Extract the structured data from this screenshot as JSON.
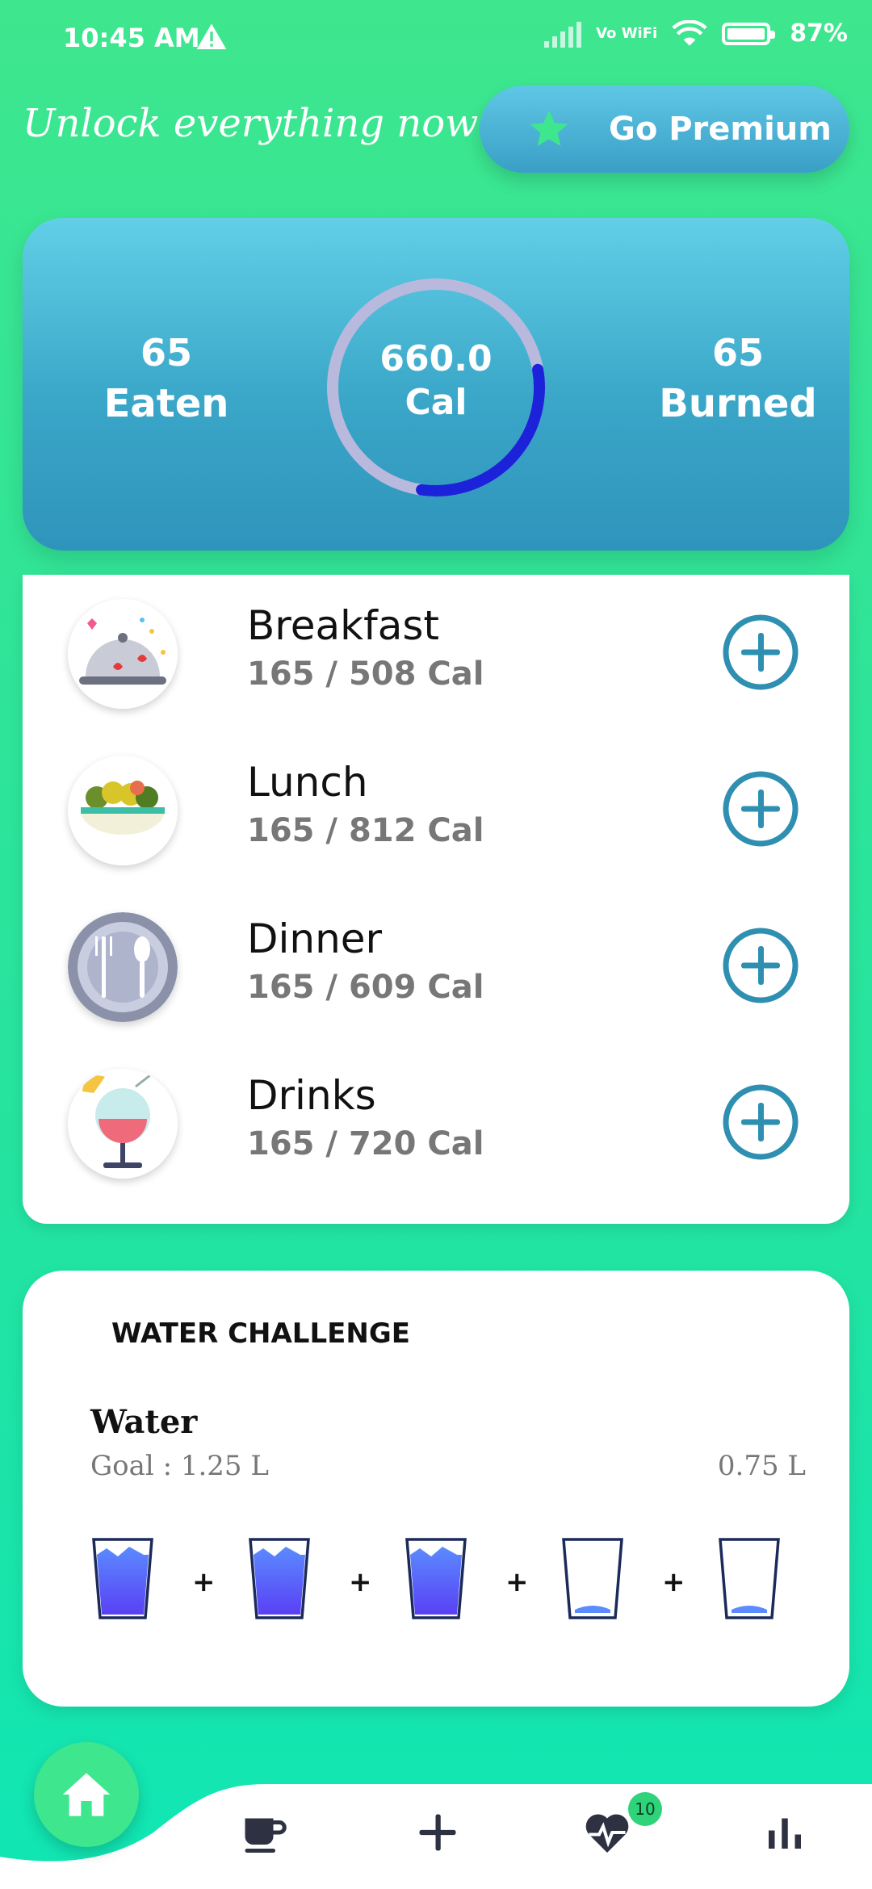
{
  "status_bar": {
    "time": "10:45 AM",
    "network": "Vo WiFi",
    "battery": "87%"
  },
  "promo": {
    "tagline": "Unlock everything now !",
    "premium_label": "Go Premium"
  },
  "calories": {
    "eaten_value": "65",
    "eaten_label": "Eaten",
    "burned_value": "65",
    "burned_label": "Burned",
    "center_value": "660.0",
    "center_unit": "Cal",
    "progress_fraction": 0.3
  },
  "meals": [
    {
      "name": "Breakfast",
      "summary": "165 / 508 Cal",
      "icon": "cloche-icon"
    },
    {
      "name": "Lunch",
      "summary": "165 / 812 Cal",
      "icon": "salad-bowl-icon"
    },
    {
      "name": "Dinner",
      "summary": "165 / 609 Cal",
      "icon": "plate-cutlery-icon"
    },
    {
      "name": "Drinks",
      "summary": "165 / 720 Cal",
      "icon": "cocktail-icon"
    }
  ],
  "water": {
    "header": "WATER CHALLENGE",
    "title": "Water",
    "goal": "Goal : 1.25 L",
    "amount": "0.75 L",
    "glasses": [
      true,
      true,
      true,
      false,
      false
    ],
    "plus": "+"
  },
  "nav": {
    "health_badge": "10"
  },
  "colors": {
    "brand_green": "#3ee68e",
    "card_blue": "#3aa6c8",
    "accent_teal": "#2e8fb0",
    "ring_progress": "#1c22d9"
  }
}
